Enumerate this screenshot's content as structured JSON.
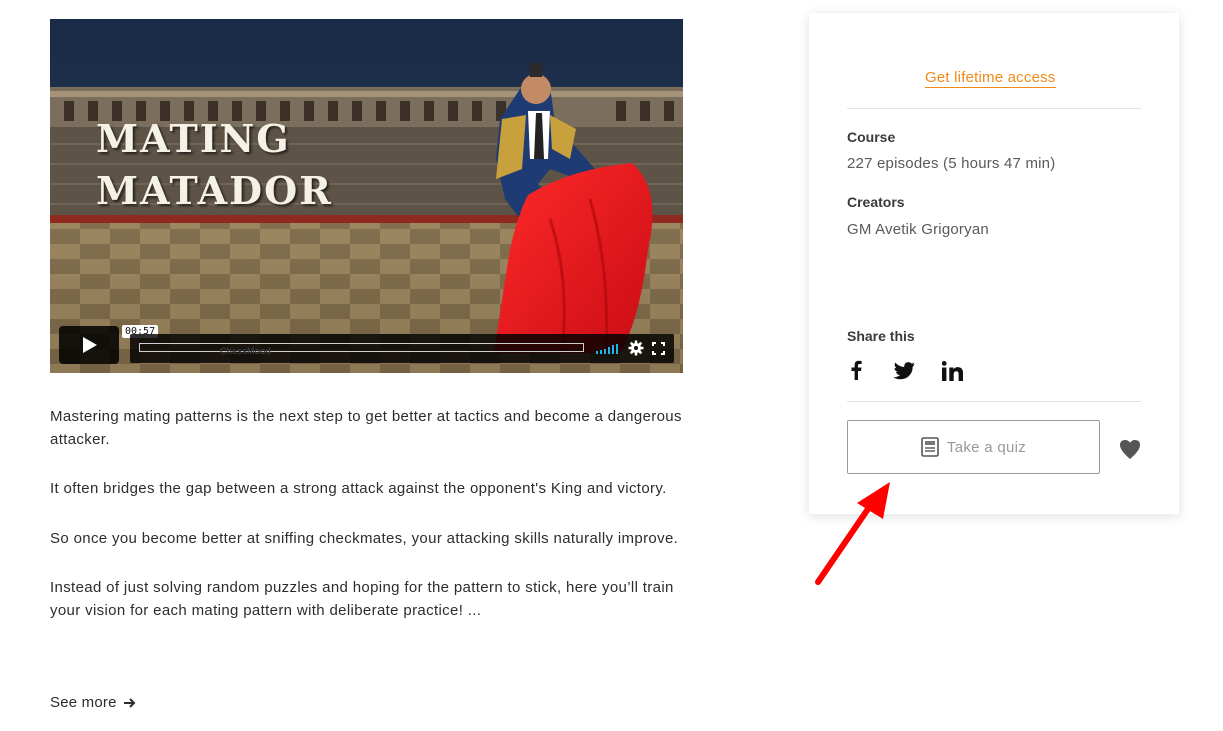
{
  "video": {
    "title": "MATING\nMATADOR",
    "timestamp": "00:57",
    "watermark": "ChessMood",
    "icons": [
      "play-icon",
      "volume-icon",
      "settings-gear-icon",
      "fullscreen-icon"
    ]
  },
  "description": {
    "paragraphs": [
      "Mastering mating patterns is the next step to get better at tactics and become a dangerous attacker.",
      "It often bridges the gap between a strong attack against the opponent's King and victory.",
      "So once you become better at sniffing checkmates, your attacking skills naturally improve.",
      "Instead of just solving random puzzles and hoping for the pattern to stick, here you’ll train your vision for each mating pattern with deliberate practice! ..."
    ],
    "see_more": "See more"
  },
  "sidebar": {
    "cta": "Get lifetime access",
    "course_label": "Course",
    "course_value": "227 episodes (5 hours 47 min)",
    "creators_label": "Creators",
    "creators_value": "GM Avetik Grigoryan",
    "share_label": "Share this",
    "share_icons": [
      "facebook-icon",
      "twitter-icon",
      "linkedin-icon"
    ],
    "quiz_button": "Take a quiz",
    "accent_color": "#ef8a17"
  },
  "annotation": {
    "arrow_color": "#ff0000"
  }
}
